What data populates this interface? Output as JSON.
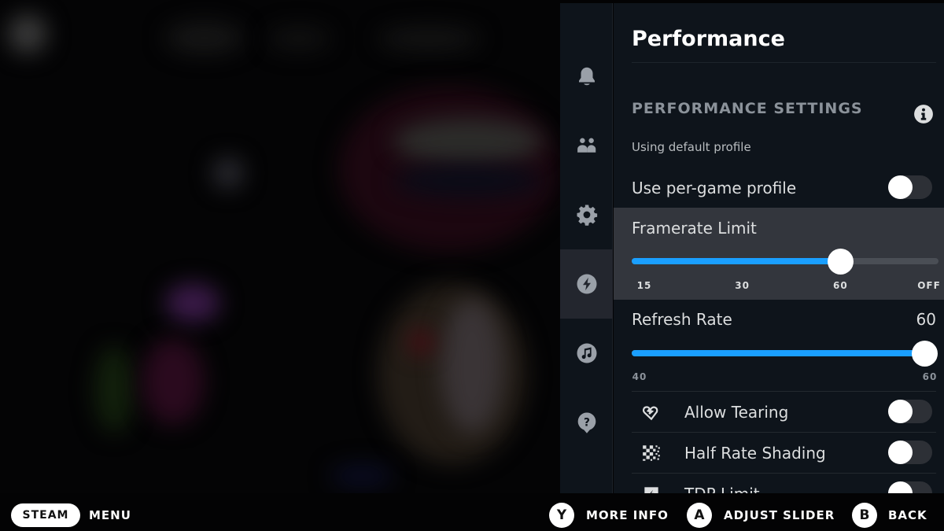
{
  "panel": {
    "title": "Performance",
    "section_heading": "PERFORMANCE SETTINGS",
    "profile_status": "Using default profile",
    "per_game_profile": {
      "label": "Use per-game profile",
      "enabled": false
    },
    "framerate_limit": {
      "label": "Framerate Limit",
      "ticks": [
        "15",
        "30",
        "60",
        "OFF"
      ],
      "selected": "60"
    },
    "refresh_rate": {
      "label": "Refresh Rate",
      "value": "60",
      "min_label": "40",
      "max_label": "60",
      "min": 40,
      "max": 60,
      "current": 60
    },
    "options": [
      {
        "label": "Allow Tearing",
        "icon": "tearing-heart-icon",
        "enabled": false
      },
      {
        "label": "Half Rate Shading",
        "icon": "checkerboard-icon",
        "enabled": false
      },
      {
        "label": "TDP Limit",
        "icon": "chip-icon",
        "enabled": false
      }
    ]
  },
  "rail": {
    "items": [
      {
        "name": "notifications",
        "icon": "bell-icon"
      },
      {
        "name": "friends",
        "icon": "friends-icon"
      },
      {
        "name": "settings",
        "icon": "gear-icon"
      },
      {
        "name": "performance",
        "icon": "lightning-icon",
        "active": true
      },
      {
        "name": "music",
        "icon": "music-note-icon"
      },
      {
        "name": "help",
        "icon": "help-icon"
      }
    ]
  },
  "footer": {
    "steam_label": "STEAM",
    "menu_label": "MENU",
    "y_glyph": "Y",
    "y_label": "MORE INFO",
    "a_glyph": "A",
    "a_label": "ADJUST SLIDER",
    "b_glyph": "B",
    "b_label": "BACK"
  },
  "colors": {
    "accent": "#1a9fff",
    "panel_bg": "#0e141b",
    "highlight_bg": "#33363d"
  }
}
